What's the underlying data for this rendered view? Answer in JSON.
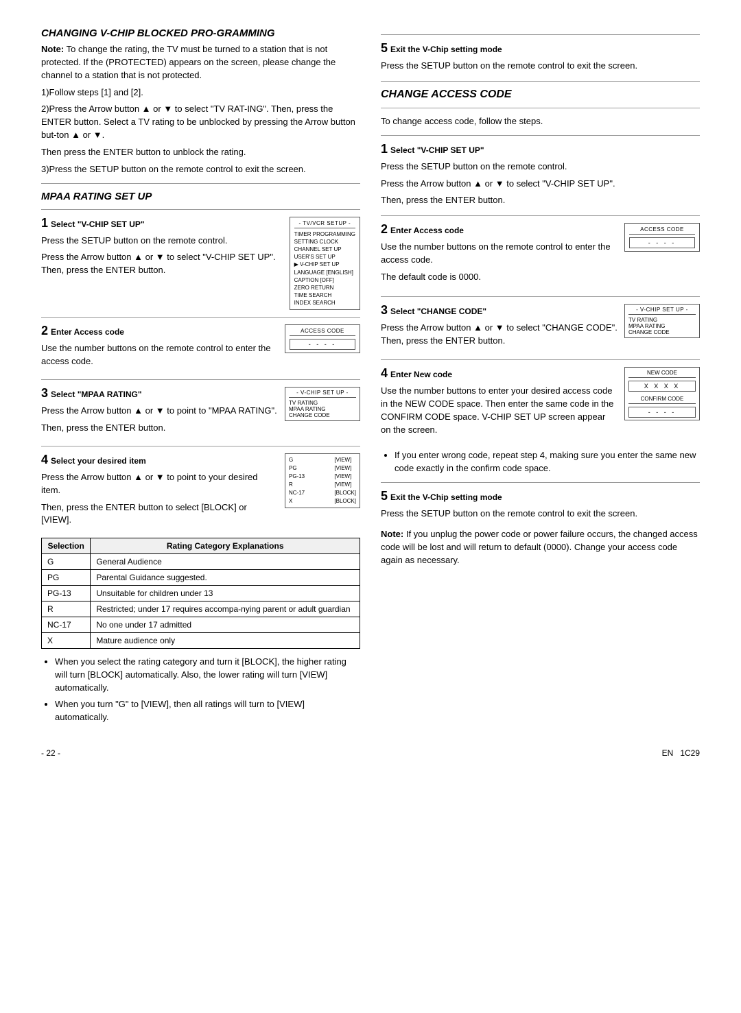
{
  "left": {
    "section1": {
      "title": "CHANGING V-CHIP BLOCKED PRO-GRAMMING",
      "note_label": "Note:",
      "note_text": "To change the rating, the TV must be turned to a station that is not protected. If the (PROTECTED) appears on the screen, please change the channel to a station that is not protected.",
      "steps_intro": [
        "1)Follow steps [1] and [2].",
        "2)Press the Arrow button ▲ or ▼ to select \"TV RAT-ING\".  Then, press the ENTER button. Select a TV rating to be unblocked by pressing the Arrow button ▲ or ▼.",
        "Then press the ENTER button to unblock the rating.",
        "3)Press the SETUP button on the remote control to exit the screen."
      ]
    },
    "mpaa": {
      "title": "MPAA RATING SET UP",
      "step1": {
        "number": "1",
        "heading": "Select \"V-CHIP SET UP\"",
        "text1": "Press the SETUP button on the remote control.",
        "text2": "Press the Arrow button ▲ or ▼ to select \"V-CHIP SET UP\". Then, press the ENTER button.",
        "box": {
          "title": "- TV/VCR SETUP -",
          "items": [
            "TIMER PROGRAMMING",
            "SETTING CLOCK",
            "CHANNEL SET UP",
            "USER'S SET UP",
            "▶ V-CHIP SET UP",
            "LANGUAGE [ENGLISH]",
            "CAPTION [OFF]",
            "ZERO RETURN",
            "TIME SEARCH",
            "INDEX SEARCH"
          ]
        }
      },
      "step2": {
        "number": "2",
        "heading": "Enter Access code",
        "text1": "Use the number buttons on the remote control to enter the access code.",
        "box": {
          "title": "ACCESS CODE",
          "code": "- - - -"
        }
      },
      "step3": {
        "number": "3",
        "heading": "Select \"MPAA RATING\"",
        "text1": "Press the Arrow button ▲ or ▼ to point to \"MPAA RATING\".",
        "text2": "Then, press the ENTER button.",
        "box": {
          "title": "- V-CHIP SET UP -",
          "items": [
            "TV RATING",
            "▶ MPAA RATING",
            "CHANGE CODE"
          ]
        }
      },
      "step4": {
        "number": "4",
        "heading": "Select your desired item",
        "text1": "Press the Arrow button ▲ or ▼ to point to your desired item.",
        "text2": "Then, press the ENTER button to select [BLOCK] or [VIEW].",
        "box": {
          "items": [
            {
              "label": "G",
              "value": "[VIEW]"
            },
            {
              "label": "PG",
              "value": "[VIEW]"
            },
            {
              "label": "PG-13",
              "value": "[VIEW]"
            },
            {
              "label": "R",
              "value": "[VIEW]"
            },
            {
              "label": "NC-17",
              "value": "[BLOCK]"
            },
            {
              "label": "X",
              "value": "[BLOCK]"
            }
          ]
        }
      },
      "table": {
        "headers": [
          "Selection",
          "Rating Category Explanations"
        ],
        "rows": [
          [
            "G",
            "General Audience"
          ],
          [
            "PG",
            "Parental Guidance suggested."
          ],
          [
            "PG-13",
            "Unsuitable for children under 13"
          ],
          [
            "R",
            "Restricted; under 17 requires accompa-nying parent or adult guardian"
          ],
          [
            "NC-17",
            "No one under 17 admitted"
          ],
          [
            "X",
            "Mature audience only"
          ]
        ]
      },
      "bullets": [
        "When you select the rating category and turn it [BLOCK], the higher rating will turn [BLOCK] automatically.  Also, the lower rating will turn [VIEW] automatically.",
        "When you turn \"G\" to [VIEW], then all ratings will turn to [VIEW] automatically."
      ]
    }
  },
  "right": {
    "step5_top": {
      "number": "5",
      "heading": "Exit the V-Chip setting mode",
      "text": "Press the SETUP button on the remote control to exit the screen."
    },
    "change_access": {
      "title": "CHANGE ACCESS CODE",
      "intro": "To change access code, follow the steps.",
      "step1": {
        "number": "1",
        "heading": "Select \"V-CHIP SET UP\"",
        "text1": "Press the SETUP button on the remote control.",
        "text2": "Press the Arrow button ▲ or ▼ to select \"V-CHIP SET UP\".",
        "text3": "Then, press the ENTER button."
      },
      "step2": {
        "number": "2",
        "heading": "Enter Access code",
        "text1": "Use the number buttons on the remote control to enter the access code.",
        "text2": "The default code is 0000.",
        "box": {
          "title": "ACCESS CODE",
          "code": "- - - -"
        }
      },
      "step3": {
        "number": "3",
        "heading": "Select \"CHANGE CODE\"",
        "text1": "Press the Arrow button ▲ or ▼ to select \"CHANGE CODE\". Then, press the ENTER button.",
        "box": {
          "title": "- V-CHIP SET UP -",
          "items": [
            "TV RATING",
            "MPAA RATING",
            "▶ CHANGE CODE"
          ]
        }
      },
      "step4": {
        "number": "4",
        "heading": "Enter New code",
        "text1": "Use the number buttons to enter your desired access code in the NEW CODE space. Then enter the same code in the CONFIRM CODE space. V-CHIP SET UP screen appear on the screen.",
        "box": {
          "new_title": "NEW CODE",
          "new_code": "X X X X",
          "confirm_title": "CONFIRM CODE",
          "confirm_code": "- - - -"
        }
      },
      "bullet": "If you enter wrong code, repeat step 4, making sure you enter the same new code exactly in the confirm code space.",
      "step5": {
        "number": "5",
        "heading": "Exit the V-Chip setting mode",
        "text": "Press the SETUP button on the remote control to exit the screen."
      },
      "note_label": "Note:",
      "note_text": "If you unplug the power code or power failure occurs, the changed access code will be lost and will return to default (0000). Change your access code again as necessary."
    }
  },
  "footer": {
    "page": "- 22 -",
    "lang": "EN",
    "code": "1C29"
  }
}
